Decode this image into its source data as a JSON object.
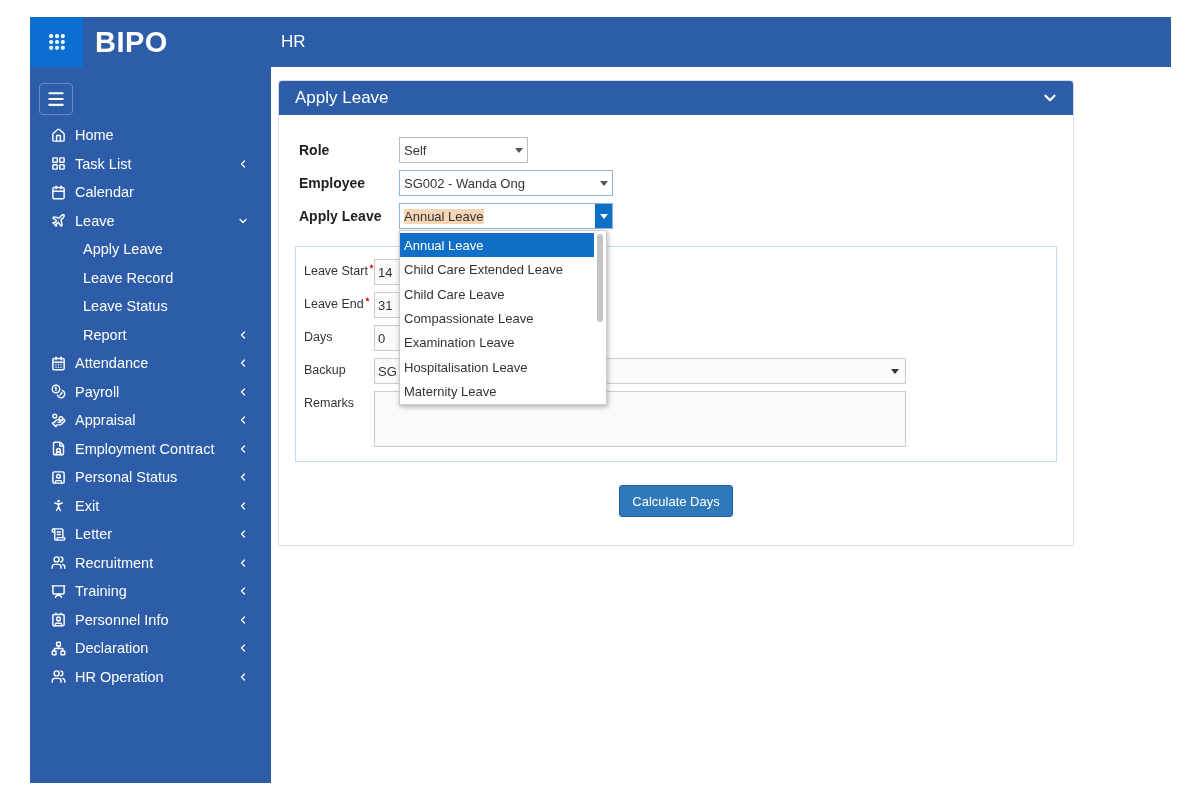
{
  "app": {
    "logo": "BIPO",
    "module": "HR"
  },
  "sidebar": {
    "items": [
      {
        "label": "Home",
        "kind": "link"
      },
      {
        "label": "Task List",
        "kind": "group",
        "expanded": false
      },
      {
        "label": "Calendar",
        "kind": "link"
      },
      {
        "label": "Leave",
        "kind": "group",
        "expanded": true,
        "children": [
          {
            "label": "Apply Leave",
            "kind": "link"
          },
          {
            "label": "Leave Record",
            "kind": "link"
          },
          {
            "label": "Leave Status",
            "kind": "link"
          },
          {
            "label": "Report",
            "kind": "group",
            "expanded": false
          }
        ]
      },
      {
        "label": "Attendance",
        "kind": "group",
        "expanded": false
      },
      {
        "label": "Payroll",
        "kind": "group",
        "expanded": false
      },
      {
        "label": "Appraisal",
        "kind": "group",
        "expanded": false
      },
      {
        "label": "Employment Contract",
        "kind": "group",
        "expanded": false
      },
      {
        "label": "Personal Status",
        "kind": "group",
        "expanded": false
      },
      {
        "label": "Exit",
        "kind": "group",
        "expanded": false
      },
      {
        "label": "Letter",
        "kind": "group",
        "expanded": false
      },
      {
        "label": "Recruitment",
        "kind": "group",
        "expanded": false
      },
      {
        "label": "Training",
        "kind": "group",
        "expanded": false
      },
      {
        "label": "Personnel Info",
        "kind": "group",
        "expanded": false
      },
      {
        "label": "Declaration",
        "kind": "group",
        "expanded": false
      },
      {
        "label": "HR Operation",
        "kind": "group",
        "expanded": false
      }
    ]
  },
  "panel": {
    "title": "Apply Leave",
    "expanded": true,
    "top_fields": [
      {
        "label": "Role",
        "value": "Self",
        "open": false
      },
      {
        "label": "Employee",
        "value": "SG002 - Wanda Ong",
        "open": false
      },
      {
        "label": "Apply Leave",
        "value": "Annual Leave",
        "open": true,
        "options": [
          {
            "label": "Annual Leave",
            "selected": true
          },
          {
            "label": "Child Care Extended Leave",
            "selected": false
          },
          {
            "label": "Child Care Leave",
            "selected": false
          },
          {
            "label": "Compassionate Leave",
            "selected": false
          },
          {
            "label": "Examination Leave",
            "selected": false
          },
          {
            "label": "Hospitalisation Leave",
            "selected": false
          },
          {
            "label": "Maternity Leave",
            "selected": false
          }
        ]
      }
    ],
    "detail_fields": [
      {
        "label": "Leave Start",
        "kind": "input",
        "required": true,
        "value": "14"
      },
      {
        "label": "Leave End",
        "kind": "input",
        "required": true,
        "value": "31"
      },
      {
        "label": "Days",
        "kind": "input",
        "required": false,
        "value": "0"
      },
      {
        "label": "Backup",
        "kind": "select",
        "required": false,
        "value": "SG"
      },
      {
        "label": "Remarks",
        "kind": "textarea",
        "required": false
      }
    ],
    "button": "Calculate Days"
  }
}
